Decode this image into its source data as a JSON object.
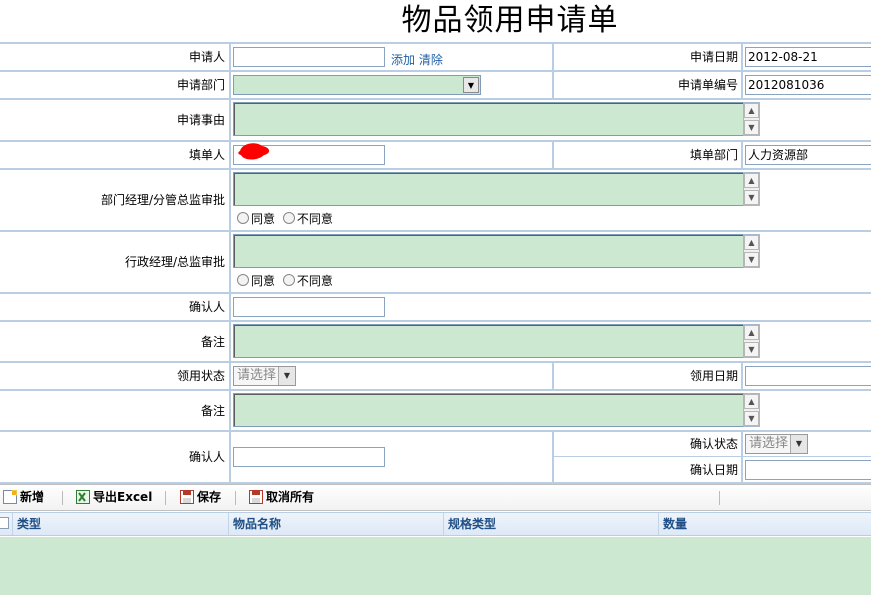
{
  "page": {
    "title": "物品领用申请单"
  },
  "form": {
    "applicant": {
      "label": "申请人",
      "value": "",
      "add_link": "添加",
      "clear_link": "清除"
    },
    "apply_date": {
      "label": "申请日期",
      "value": "2012-08-21"
    },
    "department": {
      "label": "申请部门",
      "value": ""
    },
    "form_no": {
      "label": "申请单编号",
      "value": "2012081036"
    },
    "reason": {
      "label": "申请事由",
      "value": ""
    },
    "filler": {
      "label": "填单人",
      "value": ""
    },
    "filler_dept": {
      "label": "填单部门",
      "value": "人力资源部"
    },
    "dept_manager": {
      "label": "部门经理/分管总监审批",
      "agree": "同意",
      "disagree": "不同意"
    },
    "admin_manager": {
      "label": "行政经理/总监审批",
      "agree": "同意",
      "disagree": "不同意"
    },
    "confirmer1": {
      "label": "确认人",
      "value": ""
    },
    "remark1": {
      "label": "备注"
    },
    "receive_status": {
      "label": "领用状态",
      "value": "请选择"
    },
    "receive_date": {
      "label": "领用日期",
      "value": ""
    },
    "remark2": {
      "label": "备注"
    },
    "confirmer2": {
      "label": "确认人",
      "value": ""
    },
    "confirm_status": {
      "label": "确认状态",
      "value": "请选择"
    },
    "confirm_date": {
      "label": "确认日期",
      "value": ""
    }
  },
  "toolbar": {
    "add": "新增",
    "export": "导出Excel",
    "save": "保存",
    "cancel_all": "取消所有"
  },
  "grid": {
    "columns": [
      "类型",
      "物品名称",
      "规格类型",
      "数量"
    ]
  },
  "colors": {
    "border": "#b9cde3",
    "textarea_bg": "#cde8d0",
    "link": "#1f5fa6",
    "grid_header_text": "#1f4f86"
  }
}
